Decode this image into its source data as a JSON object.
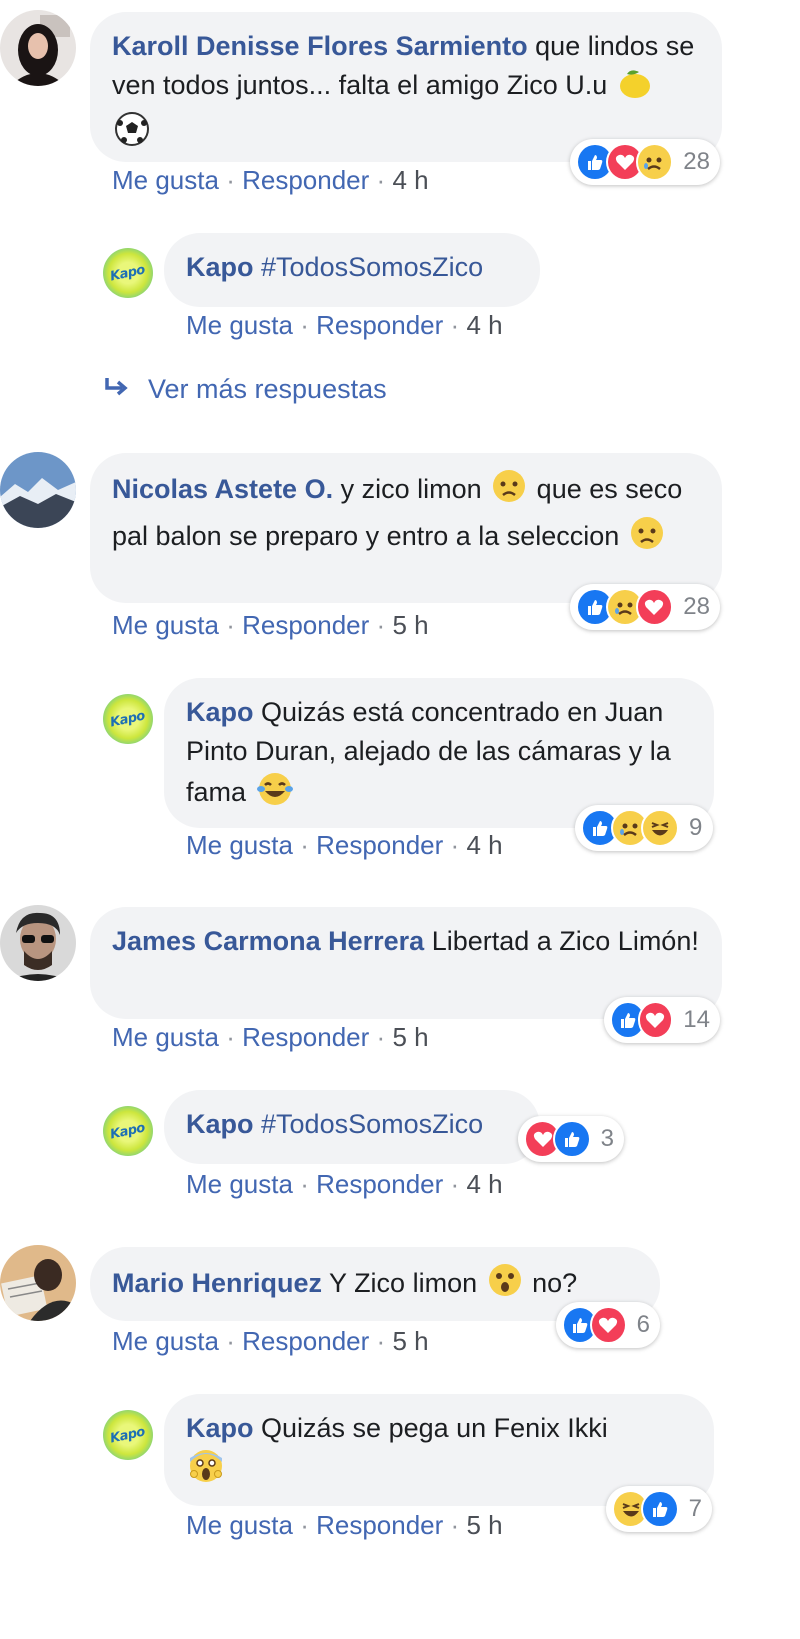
{
  "comments": [
    {
      "author": "Karoll Denisse Flores Sarmiento",
      "text": "que lindos se ven todos juntos... falta el amigo Zico U.u",
      "emoji_icons": [
        "lemon-icon",
        "soccer-ball-icon"
      ],
      "actions": {
        "like": "Me gusta",
        "reply": "Responder",
        "time": "4 h"
      },
      "reactions": {
        "icons": [
          "like",
          "love",
          "sad"
        ],
        "count": "28"
      },
      "reply": {
        "author": "Kapo",
        "text": "#TodosSomosZico",
        "actions": {
          "like": "Me gusta",
          "reply": "Responder",
          "time": "4 h"
        }
      },
      "more_replies": "Ver más respuestas"
    },
    {
      "author": "Nicolas Astete O.",
      "text_parts": [
        "y zico limon",
        "que es seco pal balon se preparo y entro a la seleccion"
      ],
      "emoji_icons": [
        "worried-face-icon",
        "worried-face-icon"
      ],
      "actions": {
        "like": "Me gusta",
        "reply": "Responder",
        "time": "5 h"
      },
      "reactions": {
        "icons": [
          "like",
          "sad",
          "love"
        ],
        "count": "28"
      },
      "reply": {
        "author": "Kapo",
        "text": "Quizás está concentrado en Juan Pinto Duran, alejado de las cámaras y la fama",
        "emoji_icons": [
          "tears-of-joy-icon"
        ],
        "actions": {
          "like": "Me gusta",
          "reply": "Responder",
          "time": "4 h"
        },
        "reactions": {
          "icons": [
            "like",
            "sad",
            "haha"
          ],
          "count": "9"
        }
      }
    },
    {
      "author": "James Carmona Herrera",
      "text": "Libertad a Zico Limón!",
      "actions": {
        "like": "Me gusta",
        "reply": "Responder",
        "time": "5 h"
      },
      "reactions": {
        "icons": [
          "like",
          "love"
        ],
        "count": "14"
      },
      "reply": {
        "author": "Kapo",
        "text": "#TodosSomosZico",
        "actions": {
          "like": "Me gusta",
          "reply": "Responder",
          "time": "4 h"
        },
        "reactions": {
          "icons": [
            "love",
            "like"
          ],
          "count": "3"
        }
      }
    },
    {
      "author": "Mario Henriquez",
      "text_parts": [
        "Y Zico limon",
        "no?"
      ],
      "emoji_icons": [
        "surprised-face-icon"
      ],
      "actions": {
        "like": "Me gusta",
        "reply": "Responder",
        "time": "5 h"
      },
      "reactions": {
        "icons": [
          "like",
          "love"
        ],
        "count": "6"
      },
      "reply": {
        "author": "Kapo",
        "text": "Quizás se pega un Fenix Ikki",
        "emoji_icons": [
          "screaming-face-icon"
        ],
        "actions": {
          "like": "Me gusta",
          "reply": "Responder",
          "time": "5 h"
        },
        "reactions": {
          "icons": [
            "haha",
            "like"
          ],
          "count": "7"
        }
      }
    }
  ],
  "page_logo_text": "Kapo",
  "colors": {
    "link": "#385898",
    "action": "#4267b2",
    "bubble": "#f2f3f5",
    "like": "#1877f2",
    "love": "#f33e58",
    "emoji": "#f7cf4a"
  }
}
